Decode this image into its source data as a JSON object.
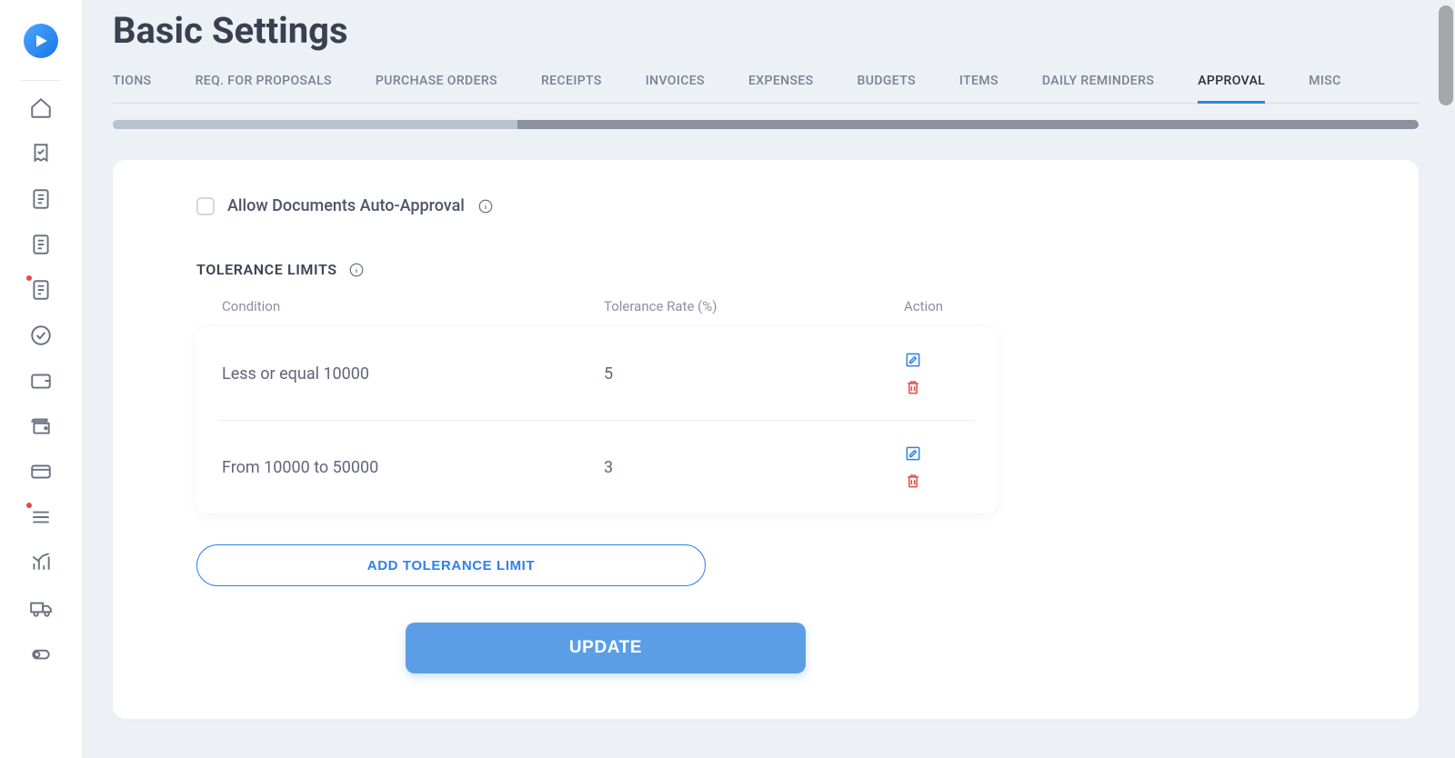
{
  "page": {
    "title": "Basic Settings"
  },
  "tabs": [
    {
      "label": "TIONS",
      "active": false
    },
    {
      "label": "REQ. FOR PROPOSALS",
      "active": false
    },
    {
      "label": "PURCHASE ORDERS",
      "active": false
    },
    {
      "label": "RECEIPTS",
      "active": false
    },
    {
      "label": "INVOICES",
      "active": false
    },
    {
      "label": "EXPENSES",
      "active": false
    },
    {
      "label": "BUDGETS",
      "active": false
    },
    {
      "label": "ITEMS",
      "active": false
    },
    {
      "label": "DAILY REMINDERS",
      "active": false
    },
    {
      "label": "APPROVAL",
      "active": true
    },
    {
      "label": "MISC",
      "active": false
    }
  ],
  "auto_approval": {
    "label": "Allow Documents Auto-Approval"
  },
  "tolerance": {
    "heading": "TOLERANCE LIMITS",
    "columns": {
      "condition": "Condition",
      "rate": "Tolerance Rate (%)",
      "action": "Action"
    },
    "rows": [
      {
        "condition": "Less or equal 10000",
        "rate": "5"
      },
      {
        "condition": "From 10000 to 50000",
        "rate": "3"
      }
    ],
    "add_label": "ADD TOLERANCE LIMIT"
  },
  "buttons": {
    "update": "UPDATE"
  },
  "sidebar_icons": [
    "home",
    "receipt-check",
    "document-1",
    "document-2",
    "invoice",
    "check-circle",
    "wallet-1",
    "wallet-2",
    "credit-card",
    "list",
    "chart",
    "truck",
    "toggle"
  ]
}
